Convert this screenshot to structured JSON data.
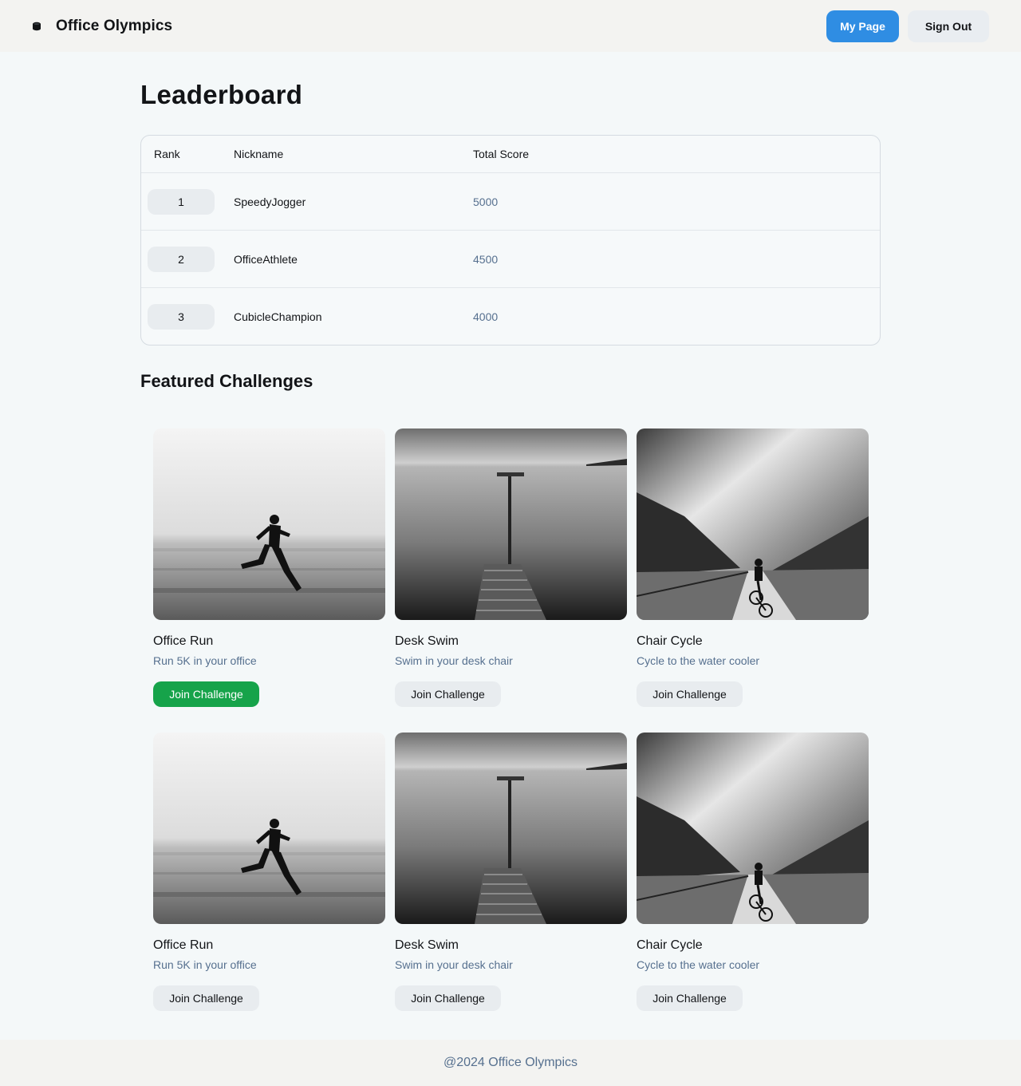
{
  "header": {
    "app_title": "Office Olympics",
    "my_page_label": "My Page",
    "sign_out_label": "Sign Out"
  },
  "main": {
    "page_title": "Leaderboard",
    "leaderboard": {
      "columns": [
        "Rank",
        "Nickname",
        "Total Score"
      ],
      "rows": [
        {
          "rank": "1",
          "nickname": "SpeedyJogger",
          "score": "5000"
        },
        {
          "rank": "2",
          "nickname": "OfficeAthlete",
          "score": "4500"
        },
        {
          "rank": "3",
          "nickname": "CubicleChampion",
          "score": "4000"
        }
      ]
    },
    "featured_title": "Featured Challenges",
    "challenges": [
      {
        "title": "Office Run",
        "description": "Run 5K in your office",
        "button": "Join Challenge",
        "image": "runner-photo",
        "highlighted": true
      },
      {
        "title": "Desk Swim",
        "description": "Swim in your desk chair",
        "button": "Join Challenge",
        "image": "pier-photo",
        "highlighted": false
      },
      {
        "title": "Chair Cycle",
        "description": "Cycle to the water cooler",
        "button": "Join Challenge",
        "image": "cyclist-photo",
        "highlighted": false
      },
      {
        "title": "Office Run",
        "description": "Run 5K in your office",
        "button": "Join Challenge",
        "image": "runner-photo",
        "highlighted": false
      },
      {
        "title": "Desk Swim",
        "description": "Swim in your desk chair",
        "button": "Join Challenge",
        "image": "pier-photo",
        "highlighted": false
      },
      {
        "title": "Chair Cycle",
        "description": "Cycle to the water cooler",
        "button": "Join Challenge",
        "image": "cyclist-photo",
        "highlighted": false
      }
    ]
  },
  "footer": {
    "text": "@2024 Office Olympics"
  },
  "colors": {
    "primary_button": "#2f8de3",
    "active_join_button": "#16a34a",
    "muted_text": "#56708f"
  }
}
